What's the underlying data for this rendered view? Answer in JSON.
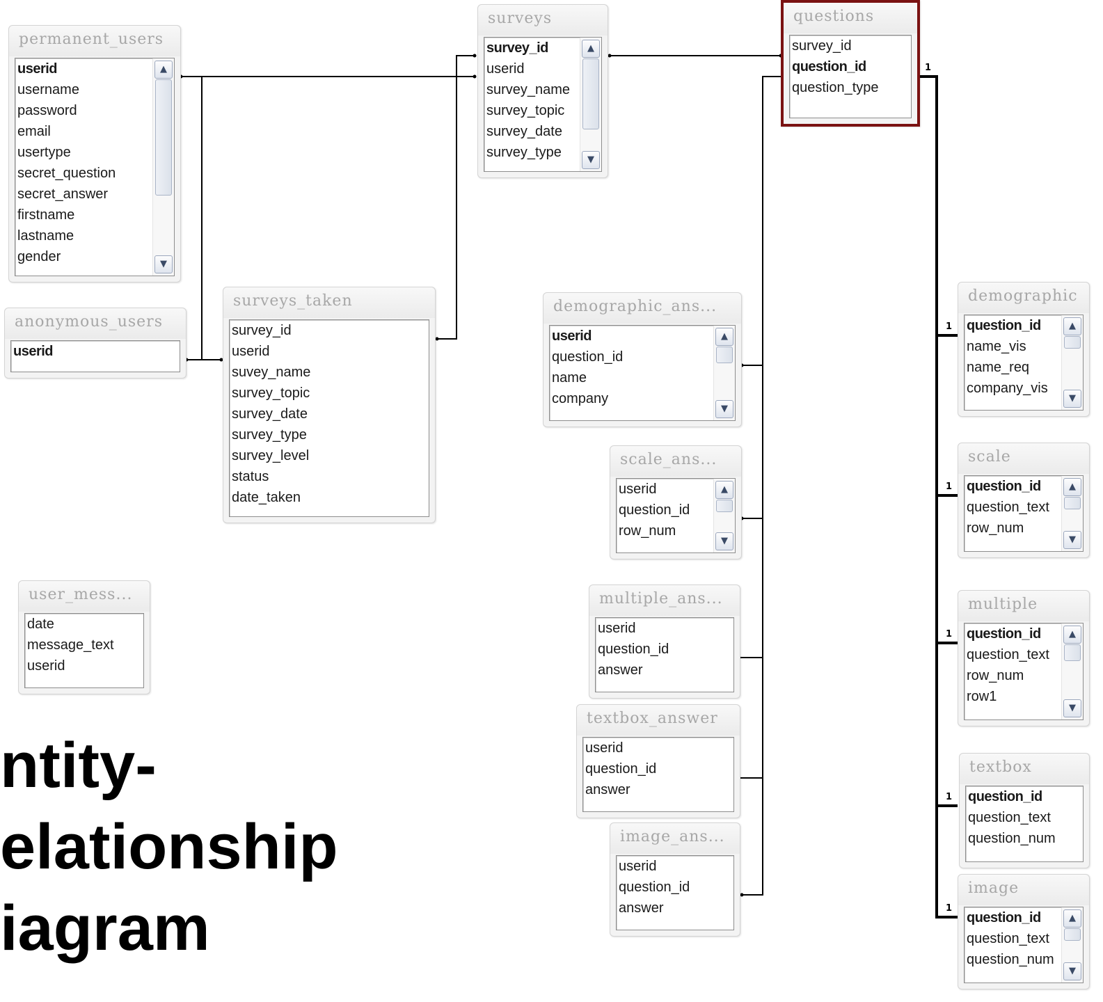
{
  "tables": {
    "permanent_users": {
      "name": "permanent_users",
      "fields": [
        "userid",
        "username",
        "password",
        "email",
        "usertype",
        "secret_question",
        "secret_answer",
        "firstname",
        "lastname",
        "gender"
      ],
      "pk": [
        "userid"
      ]
    },
    "anonymous_users": {
      "name": "anonymous_users",
      "fields": [
        "userid"
      ],
      "pk": [
        "userid"
      ]
    },
    "user_messages": {
      "name": "user_mess...",
      "fields": [
        "date",
        "message_text",
        "userid"
      ],
      "pk": []
    },
    "surveys": {
      "name": "surveys",
      "fields": [
        "survey_id",
        "userid",
        "survey_name",
        "survey_topic",
        "survey_date",
        "survey_type"
      ],
      "pk": [
        "survey_id"
      ]
    },
    "surveys_taken": {
      "name": "surveys_taken",
      "fields": [
        "survey_id",
        "userid",
        "suvey_name",
        "survey_topic",
        "survey_date",
        "survey_type",
        "survey_level",
        "status",
        "date_taken"
      ],
      "pk": []
    },
    "questions": {
      "name": "questions",
      "fields": [
        "survey_id",
        "question_id",
        "question_type"
      ],
      "pk": [
        "question_id"
      ]
    },
    "demographic_ans": {
      "name": "demographic_ans...",
      "fields": [
        "userid",
        "question_id",
        "name",
        "company"
      ],
      "pk": [
        "userid"
      ]
    },
    "scale_ans": {
      "name": "scale_ans...",
      "fields": [
        "userid",
        "question_id",
        "row_num"
      ],
      "pk": []
    },
    "multiple_ans": {
      "name": "multiple_ans...",
      "fields": [
        "userid",
        "question_id",
        "answer"
      ],
      "pk": []
    },
    "textbox_answer": {
      "name": "textbox_answer",
      "fields": [
        "userid",
        "question_id",
        "answer"
      ],
      "pk": []
    },
    "image_ans": {
      "name": "image_ans...",
      "fields": [
        "userid",
        "question_id",
        "answer"
      ],
      "pk": []
    },
    "demographic": {
      "name": "demographic",
      "fields": [
        "question_id",
        "name_vis",
        "name_req",
        "company_vis"
      ],
      "pk": [
        "question_id"
      ]
    },
    "scale": {
      "name": "scale",
      "fields": [
        "question_id",
        "question_text",
        "row_num"
      ],
      "pk": [
        "question_id"
      ]
    },
    "multiple": {
      "name": "multiple",
      "fields": [
        "question_id",
        "question_text",
        "row_num",
        "row1"
      ],
      "pk": [
        "question_id"
      ]
    },
    "textbox": {
      "name": "textbox",
      "fields": [
        "question_id",
        "question_text",
        "question_num"
      ],
      "pk": [
        "question_id"
      ]
    },
    "image": {
      "name": "image",
      "fields": [
        "question_id",
        "question_text",
        "question_num"
      ],
      "pk": [
        "question_id"
      ]
    }
  },
  "relationship_label": "1",
  "title_lines": [
    "ntity-",
    "elationship",
    "iagram"
  ],
  "colors": {
    "selected_border": "#7a1212",
    "line": "#000000",
    "header_text": "#a7a7a7"
  }
}
